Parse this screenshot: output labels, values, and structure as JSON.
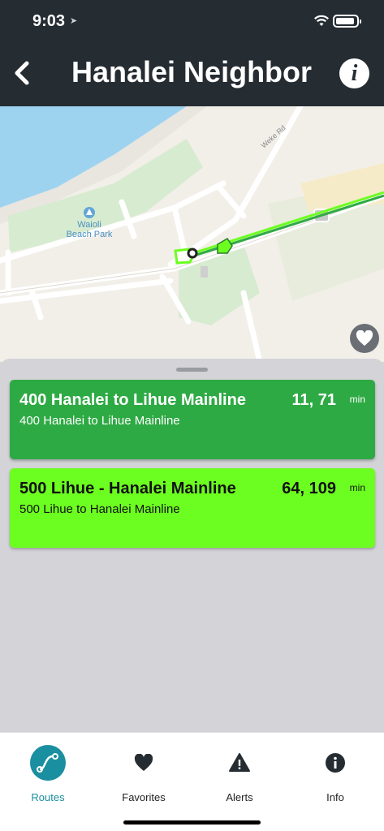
{
  "status_bar": {
    "time": "9:03"
  },
  "header": {
    "title": "Hanalei Neighborhood"
  },
  "map": {
    "road_label": "Weke Rd",
    "park_label_line1": "Waioli",
    "park_label_line2": "Beach Park",
    "colors": {
      "water": "#9ed3f0",
      "park": "#d7ebd0",
      "land": "#f2efe9",
      "route_line": "#6cfe20"
    }
  },
  "routes": [
    {
      "name": "400 Hanalei to Lihue Mainline",
      "description": "400 Hanalei to Lihue Mainline",
      "times": "11, 71",
      "unit": "min",
      "color": "#2eaa44"
    },
    {
      "name": "500 Lihue - Hanalei Mainline",
      "description": "500 Lihue to Hanalei Mainline",
      "times": "64, 109",
      "unit": "min",
      "color": "#6cfe20"
    }
  ],
  "tabs": [
    {
      "label": "Routes",
      "icon": "routes-icon",
      "active": true
    },
    {
      "label": "Favorites",
      "icon": "heart-icon",
      "active": false
    },
    {
      "label": "Alerts",
      "icon": "alert-icon",
      "active": false
    },
    {
      "label": "Info",
      "icon": "info-icon",
      "active": false
    }
  ],
  "accent_color": "#1a8fa0"
}
